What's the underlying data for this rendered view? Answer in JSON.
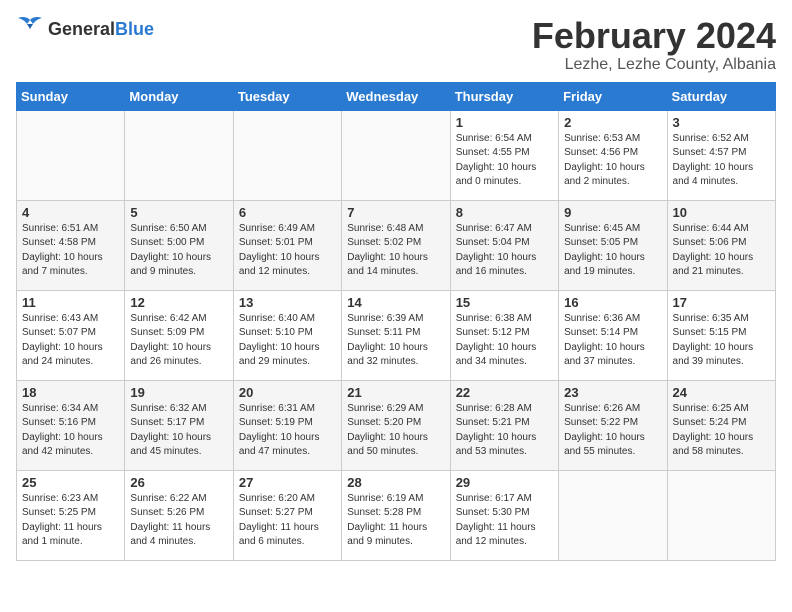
{
  "logo": {
    "general": "General",
    "blue": "Blue"
  },
  "header": {
    "month_year": "February 2024",
    "location": "Lezhe, Lezhe County, Albania"
  },
  "days_of_week": [
    "Sunday",
    "Monday",
    "Tuesday",
    "Wednesday",
    "Thursday",
    "Friday",
    "Saturday"
  ],
  "weeks": [
    [
      {
        "day": "",
        "sunrise": "",
        "sunset": "",
        "daylight": "",
        "empty": true
      },
      {
        "day": "",
        "sunrise": "",
        "sunset": "",
        "daylight": "",
        "empty": true
      },
      {
        "day": "",
        "sunrise": "",
        "sunset": "",
        "daylight": "",
        "empty": true
      },
      {
        "day": "",
        "sunrise": "",
        "sunset": "",
        "daylight": "",
        "empty": true
      },
      {
        "day": "1",
        "sunrise": "Sunrise: 6:54 AM",
        "sunset": "Sunset: 4:55 PM",
        "daylight": "Daylight: 10 hours and 0 minutes.",
        "empty": false
      },
      {
        "day": "2",
        "sunrise": "Sunrise: 6:53 AM",
        "sunset": "Sunset: 4:56 PM",
        "daylight": "Daylight: 10 hours and 2 minutes.",
        "empty": false
      },
      {
        "day": "3",
        "sunrise": "Sunrise: 6:52 AM",
        "sunset": "Sunset: 4:57 PM",
        "daylight": "Daylight: 10 hours and 4 minutes.",
        "empty": false
      }
    ],
    [
      {
        "day": "4",
        "sunrise": "Sunrise: 6:51 AM",
        "sunset": "Sunset: 4:58 PM",
        "daylight": "Daylight: 10 hours and 7 minutes.",
        "empty": false
      },
      {
        "day": "5",
        "sunrise": "Sunrise: 6:50 AM",
        "sunset": "Sunset: 5:00 PM",
        "daylight": "Daylight: 10 hours and 9 minutes.",
        "empty": false
      },
      {
        "day": "6",
        "sunrise": "Sunrise: 6:49 AM",
        "sunset": "Sunset: 5:01 PM",
        "daylight": "Daylight: 10 hours and 12 minutes.",
        "empty": false
      },
      {
        "day": "7",
        "sunrise": "Sunrise: 6:48 AM",
        "sunset": "Sunset: 5:02 PM",
        "daylight": "Daylight: 10 hours and 14 minutes.",
        "empty": false
      },
      {
        "day": "8",
        "sunrise": "Sunrise: 6:47 AM",
        "sunset": "Sunset: 5:04 PM",
        "daylight": "Daylight: 10 hours and 16 minutes.",
        "empty": false
      },
      {
        "day": "9",
        "sunrise": "Sunrise: 6:45 AM",
        "sunset": "Sunset: 5:05 PM",
        "daylight": "Daylight: 10 hours and 19 minutes.",
        "empty": false
      },
      {
        "day": "10",
        "sunrise": "Sunrise: 6:44 AM",
        "sunset": "Sunset: 5:06 PM",
        "daylight": "Daylight: 10 hours and 21 minutes.",
        "empty": false
      }
    ],
    [
      {
        "day": "11",
        "sunrise": "Sunrise: 6:43 AM",
        "sunset": "Sunset: 5:07 PM",
        "daylight": "Daylight: 10 hours and 24 minutes.",
        "empty": false
      },
      {
        "day": "12",
        "sunrise": "Sunrise: 6:42 AM",
        "sunset": "Sunset: 5:09 PM",
        "daylight": "Daylight: 10 hours and 26 minutes.",
        "empty": false
      },
      {
        "day": "13",
        "sunrise": "Sunrise: 6:40 AM",
        "sunset": "Sunset: 5:10 PM",
        "daylight": "Daylight: 10 hours and 29 minutes.",
        "empty": false
      },
      {
        "day": "14",
        "sunrise": "Sunrise: 6:39 AM",
        "sunset": "Sunset: 5:11 PM",
        "daylight": "Daylight: 10 hours and 32 minutes.",
        "empty": false
      },
      {
        "day": "15",
        "sunrise": "Sunrise: 6:38 AM",
        "sunset": "Sunset: 5:12 PM",
        "daylight": "Daylight: 10 hours and 34 minutes.",
        "empty": false
      },
      {
        "day": "16",
        "sunrise": "Sunrise: 6:36 AM",
        "sunset": "Sunset: 5:14 PM",
        "daylight": "Daylight: 10 hours and 37 minutes.",
        "empty": false
      },
      {
        "day": "17",
        "sunrise": "Sunrise: 6:35 AM",
        "sunset": "Sunset: 5:15 PM",
        "daylight": "Daylight: 10 hours and 39 minutes.",
        "empty": false
      }
    ],
    [
      {
        "day": "18",
        "sunrise": "Sunrise: 6:34 AM",
        "sunset": "Sunset: 5:16 PM",
        "daylight": "Daylight: 10 hours and 42 minutes.",
        "empty": false
      },
      {
        "day": "19",
        "sunrise": "Sunrise: 6:32 AM",
        "sunset": "Sunset: 5:17 PM",
        "daylight": "Daylight: 10 hours and 45 minutes.",
        "empty": false
      },
      {
        "day": "20",
        "sunrise": "Sunrise: 6:31 AM",
        "sunset": "Sunset: 5:19 PM",
        "daylight": "Daylight: 10 hours and 47 minutes.",
        "empty": false
      },
      {
        "day": "21",
        "sunrise": "Sunrise: 6:29 AM",
        "sunset": "Sunset: 5:20 PM",
        "daylight": "Daylight: 10 hours and 50 minutes.",
        "empty": false
      },
      {
        "day": "22",
        "sunrise": "Sunrise: 6:28 AM",
        "sunset": "Sunset: 5:21 PM",
        "daylight": "Daylight: 10 hours and 53 minutes.",
        "empty": false
      },
      {
        "day": "23",
        "sunrise": "Sunrise: 6:26 AM",
        "sunset": "Sunset: 5:22 PM",
        "daylight": "Daylight: 10 hours and 55 minutes.",
        "empty": false
      },
      {
        "day": "24",
        "sunrise": "Sunrise: 6:25 AM",
        "sunset": "Sunset: 5:24 PM",
        "daylight": "Daylight: 10 hours and 58 minutes.",
        "empty": false
      }
    ],
    [
      {
        "day": "25",
        "sunrise": "Sunrise: 6:23 AM",
        "sunset": "Sunset: 5:25 PM",
        "daylight": "Daylight: 11 hours and 1 minute.",
        "empty": false
      },
      {
        "day": "26",
        "sunrise": "Sunrise: 6:22 AM",
        "sunset": "Sunset: 5:26 PM",
        "daylight": "Daylight: 11 hours and 4 minutes.",
        "empty": false
      },
      {
        "day": "27",
        "sunrise": "Sunrise: 6:20 AM",
        "sunset": "Sunset: 5:27 PM",
        "daylight": "Daylight: 11 hours and 6 minutes.",
        "empty": false
      },
      {
        "day": "28",
        "sunrise": "Sunrise: 6:19 AM",
        "sunset": "Sunset: 5:28 PM",
        "daylight": "Daylight: 11 hours and 9 minutes.",
        "empty": false
      },
      {
        "day": "29",
        "sunrise": "Sunrise: 6:17 AM",
        "sunset": "Sunset: 5:30 PM",
        "daylight": "Daylight: 11 hours and 12 minutes.",
        "empty": false
      },
      {
        "day": "",
        "sunrise": "",
        "sunset": "",
        "daylight": "",
        "empty": true
      },
      {
        "day": "",
        "sunrise": "",
        "sunset": "",
        "daylight": "",
        "empty": true
      }
    ]
  ]
}
